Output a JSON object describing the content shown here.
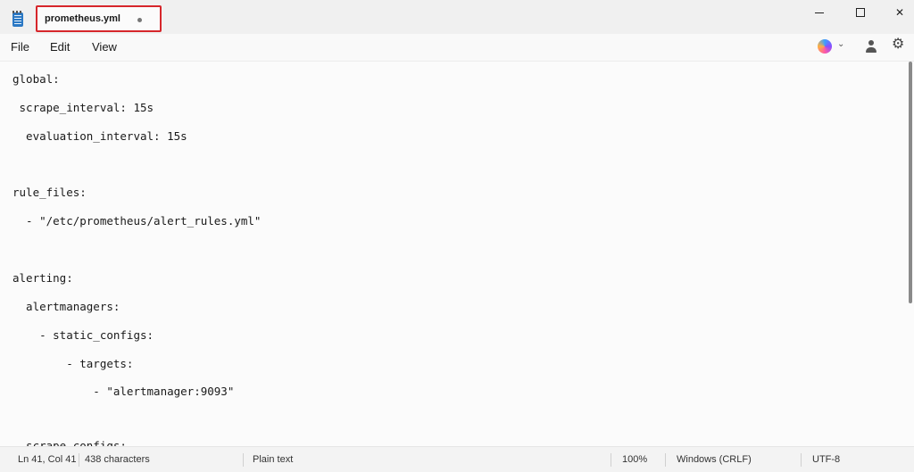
{
  "tab": {
    "title": "prometheus.yml"
  },
  "menu": {
    "file": "File",
    "edit": "Edit",
    "view": "View"
  },
  "window_controls": {
    "close": "✕"
  },
  "toolbar": {
    "chevron": "⌄",
    "gear": "⚙"
  },
  "editor": {
    "lines": [
      "global:",
      " scrape_interval: 15s",
      "  evaluation_interval: 15s",
      "",
      "rule_files:",
      "  - \"/etc/prometheus/alert_rules.yml\"",
      "",
      "alerting:",
      "  alertmanagers:",
      "    - static_configs:",
      "        - targets:",
      "            - \"alertmanager:9093\"",
      "",
      "  scrape_configs:"
    ]
  },
  "status": {
    "position": "Ln 41, Col 41",
    "characters": "438 characters",
    "language": "Plain text",
    "zoom": "100%",
    "line_ending": "Windows (CRLF)",
    "encoding": "UTF-8"
  }
}
